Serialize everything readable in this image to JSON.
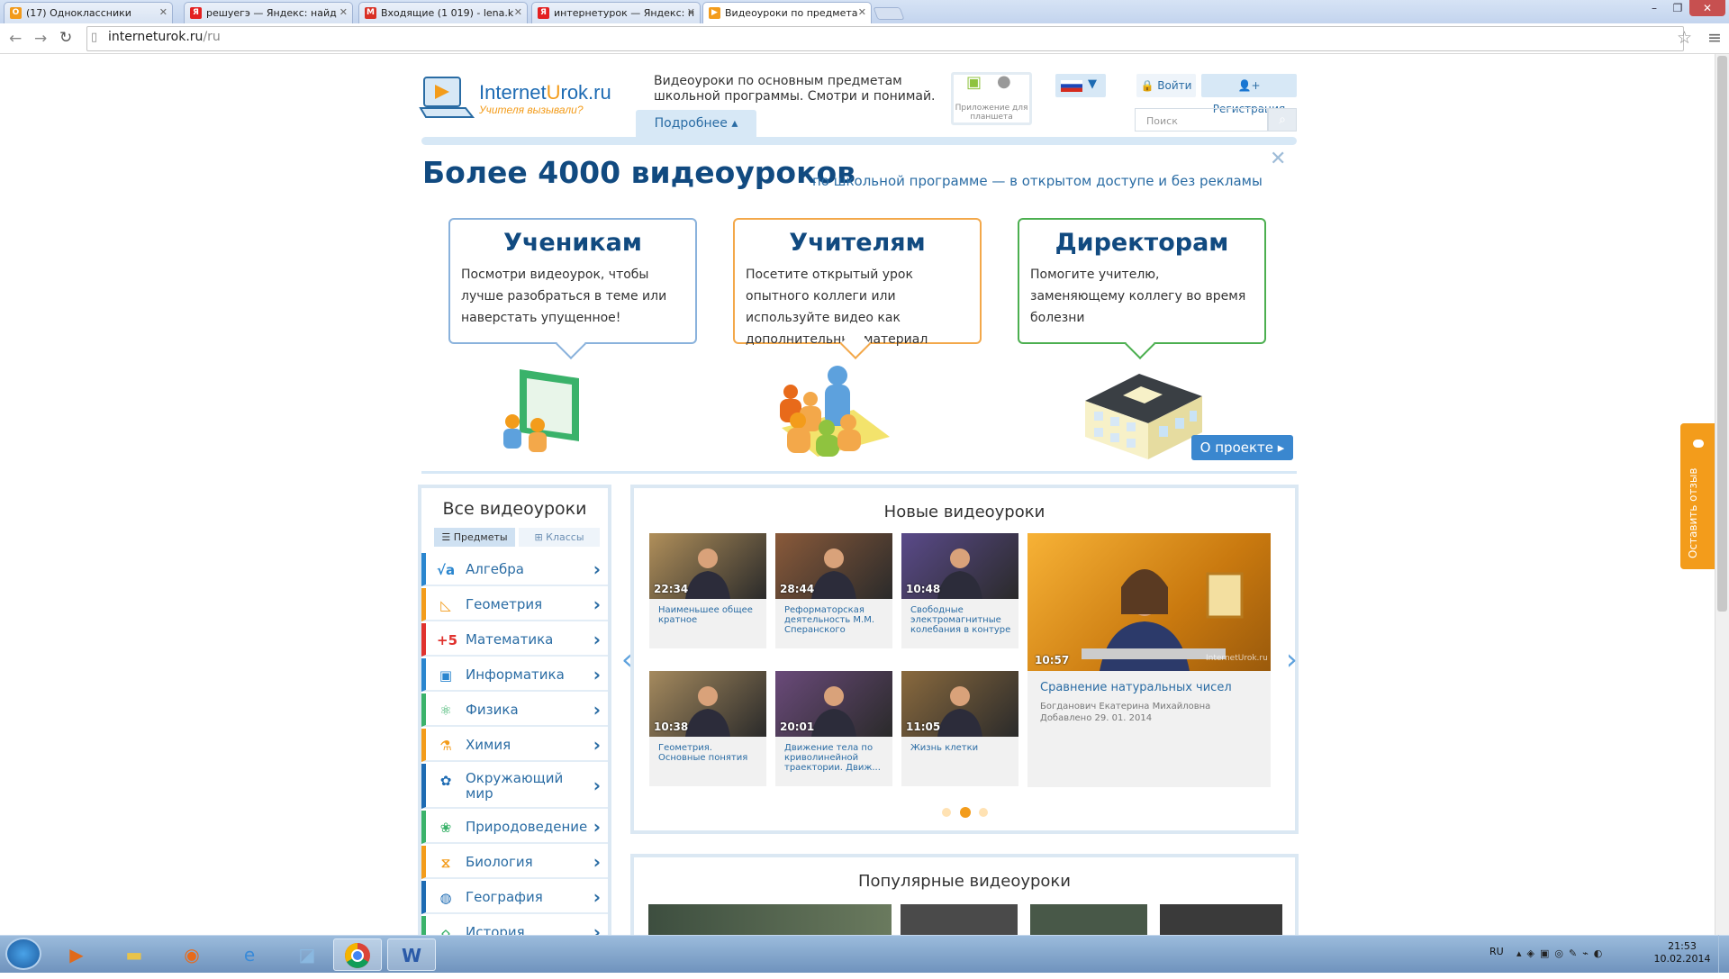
{
  "browser": {
    "tabs": [
      {
        "title": "(17) Одноклассники",
        "icon_color": "#f29a1b",
        "icon_glyph": "O"
      },
      {
        "title": "решуегэ — Яндекс: найд",
        "icon_color": "#e32020",
        "icon_glyph": "Я"
      },
      {
        "title": "Входящие (1 019) - lena.k",
        "icon_color": "#d93025",
        "icon_glyph": "M"
      },
      {
        "title": "интернетурок — Яндекс: н",
        "icon_color": "#e32020",
        "icon_glyph": "Я"
      },
      {
        "title": "Видеоуроки по предмета",
        "icon_color": "#f39c1b",
        "icon_glyph": "▶"
      }
    ],
    "url_host": "interneturok.ru",
    "url_path": "/ru"
  },
  "header": {
    "logo_name_part1": "Internet",
    "logo_name_part2": "U",
    "logo_name_part3": "rok.ru",
    "logo_slogan": "Учителя вызывали?",
    "tagline": "Видеоуроки по основным предметам школьной программы. Смотри и понимай.",
    "more_label": "Подробнее ▴",
    "apps_label": "Приложение для планшета",
    "login_label": "🔒 Войти",
    "register_label": "Регистрация",
    "search_placeholder": "Поиск"
  },
  "banner": {
    "title": "Более 4000 видеоуроков",
    "subtitle": "по школьной программе — в открытом доступе и без рекламы",
    "cards": [
      {
        "title": "Ученикам",
        "text": "Посмотри видеоурок, чтобы лучше разобраться в теме или наверстать упущенное!"
      },
      {
        "title": "Учителям",
        "text": "Посетите открытый урок опытного коллеги или используйте видео как дополнительный материал"
      },
      {
        "title": "Директорам",
        "text": "Помогите учителю, заменяющему коллегу во время болезни"
      }
    ],
    "about_label": "О проекте ▸"
  },
  "sidebar": {
    "title": "Все видеоуроки",
    "tab_subjects": "Предметы",
    "tab_classes": "Классы",
    "subjects": [
      {
        "label": "Алгебра",
        "color": "#2a86cf",
        "glyph": "√a"
      },
      {
        "label": "Геометрия",
        "color": "#f39c1b",
        "glyph": "◺"
      },
      {
        "label": "Математика",
        "color": "#e0322e",
        "glyph": "+5"
      },
      {
        "label": "Информатика",
        "color": "#2a86cf",
        "glyph": "▣"
      },
      {
        "label": "Физика",
        "color": "#3ab26a",
        "glyph": "⚛"
      },
      {
        "label": "Химия",
        "color": "#f39c1b",
        "glyph": "⚗"
      },
      {
        "label": "Окружающий мир",
        "color": "#1d6bb3",
        "glyph": "✿"
      },
      {
        "label": "Природоведение",
        "color": "#3ab26a",
        "glyph": "❀"
      },
      {
        "label": "Биология",
        "color": "#f39c1b",
        "glyph": "⧖"
      },
      {
        "label": "География",
        "color": "#1d6bb3",
        "glyph": "◍"
      },
      {
        "label": "История",
        "color": "#3ab26a",
        "glyph": "⌂"
      }
    ]
  },
  "new_videos": {
    "title": "Новые видеоуроки",
    "items": [
      {
        "duration": "22:34",
        "caption": "Наименьшее общее кратное",
        "thumb": "#b08f5a"
      },
      {
        "duration": "28:44",
        "caption": "Реформаторская деятельность М.М. Сперанского",
        "thumb": "#8a5a3a"
      },
      {
        "duration": "10:48",
        "caption": "Свободные электромагнитные колебания в контуре",
        "thumb": "#5a4a8a"
      },
      {
        "duration": "10:38",
        "caption": "Геометрия. Основные понятия",
        "thumb": "#a58a5e"
      },
      {
        "duration": "20:01",
        "caption": "Движение тела по криволинейной траектории. Движ...",
        "thumb": "#6a4a7a"
      },
      {
        "duration": "11:05",
        "caption": "Жизнь клетки",
        "thumb": "#8a6a3e"
      }
    ],
    "featured": {
      "duration": "10:57",
      "title": "Сравнение натуральных чисел",
      "author": "Богданович Екатерина Михайловна",
      "added": "Добавлено 29. 01. 2014",
      "watermark": "InternetUrok.ru"
    },
    "active_page": 2
  },
  "popular_videos": {
    "title": "Популярные видеоуроки"
  },
  "feedback_label": "Оставить отзыв",
  "taskbar": {
    "lang": "RU",
    "time": "21:53",
    "date": "10.02.2014"
  }
}
